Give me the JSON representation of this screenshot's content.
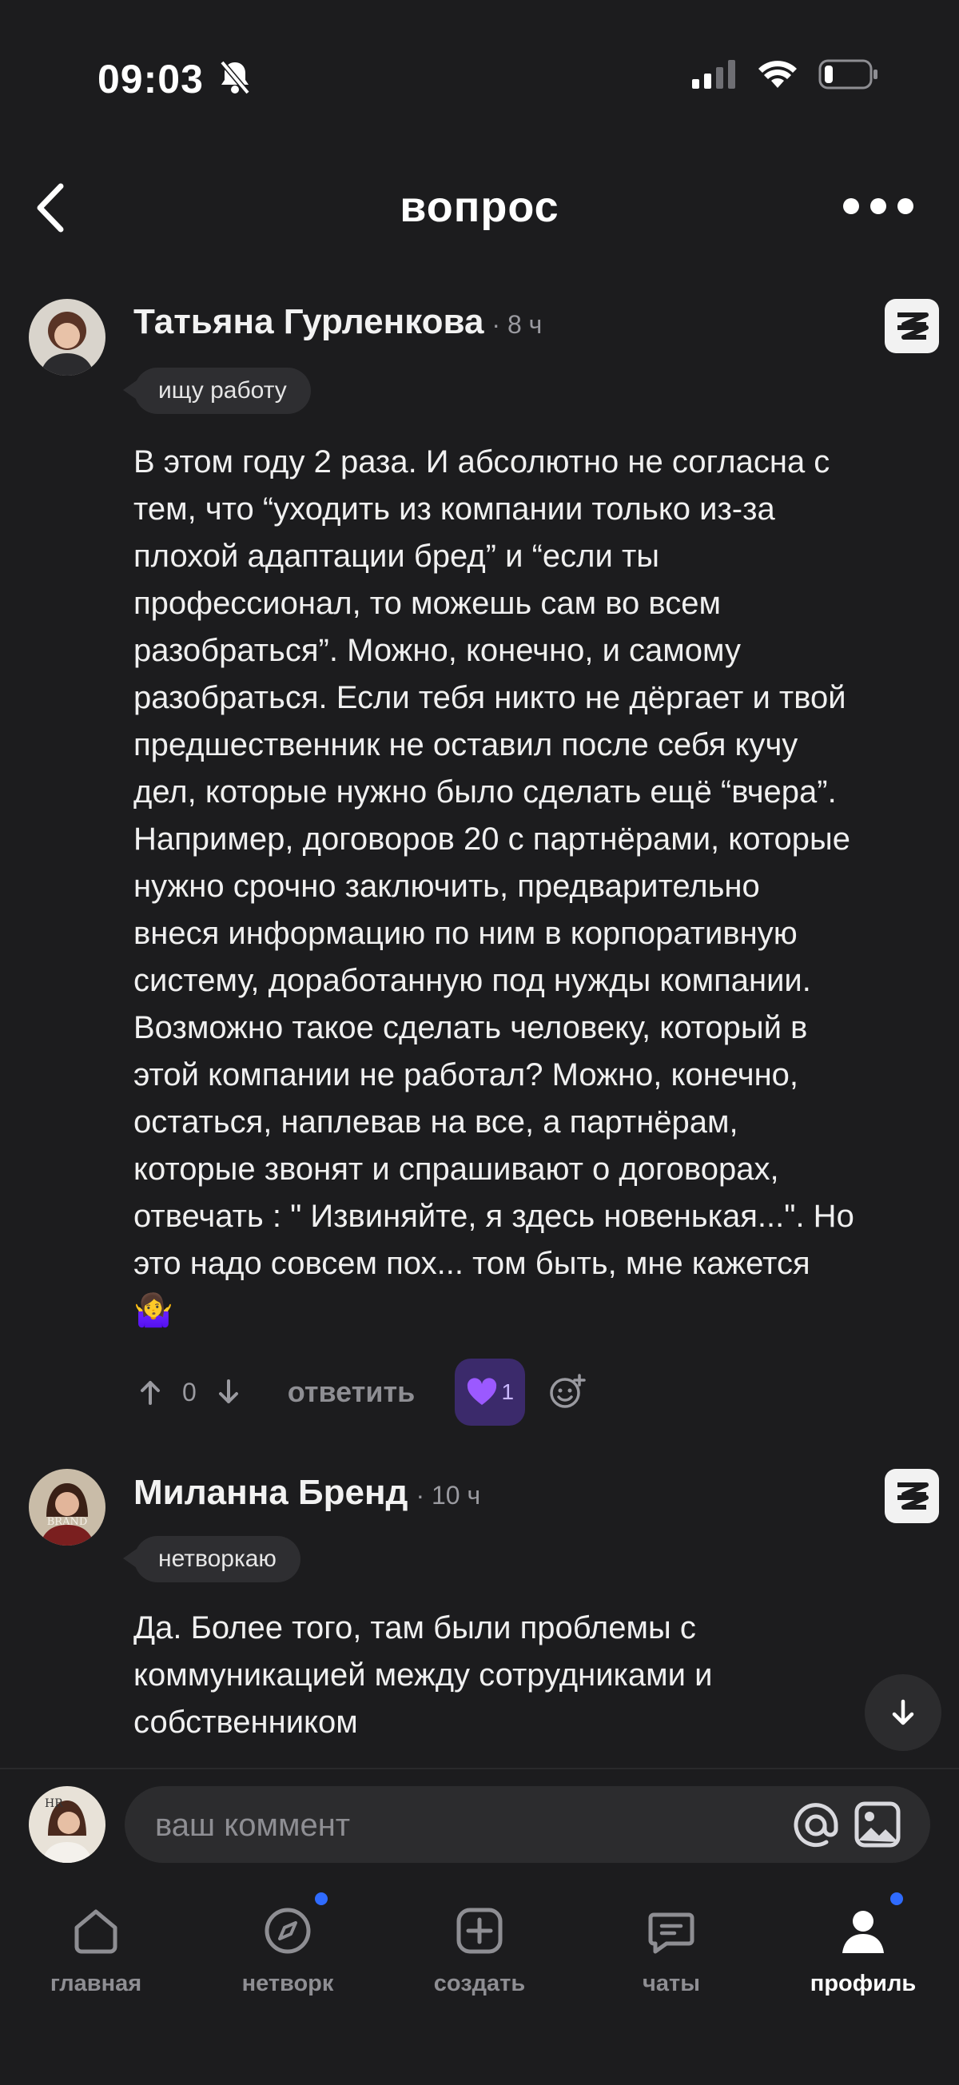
{
  "status_bar": {
    "time": "09:03"
  },
  "header": {
    "title": "вопрос"
  },
  "comments": [
    {
      "author": "Татьяна Гурленкова",
      "time": "· 8 ч",
      "badge": "ищу работу",
      "text": "В этом году 2 раза. И абсолютно не согласна с\nтем, что “уходить из компании только из-за\nплохой адаптации бред” и “если ты\nпрофессионал, то можешь сам во всем\nразобраться”. Можно, конечно, и самому\nразобраться. Если тебя никто не дёргает и твой\nпредшественник не оставил после себя кучу\nдел, которые нужно было сделать ещё “вчера”.\nНапример, договоров 20 с партнёрами, которые\nнужно срочно заключить, предварительно\nвнеся информацию по ним в корпоративную\nсистему, доработанную под нужды компании.\nВозможно такое сделать человеку, который в\nэтой компании не работал? Можно, конечно,\nостаться, наплевав на все, а партнёрам,\nкоторые звонят и спрашивают о договорах,\nотвечать : \" Извиняйте, я здесь новенькая...\". Но\nэто надо совсем пох... том быть, мне кажется\n🤷‍♀️",
      "vote_count": "0",
      "reply_label": "ответить",
      "reaction_count": "1"
    },
    {
      "author": "Миланна Бренд",
      "time": "· 10 ч",
      "badge": "нетворкаю",
      "text": "Да. Более того, там были проблемы с\nкоммуникацией между сотрудниками и\nсобственником"
    }
  ],
  "composer": {
    "placeholder": "ваш коммент"
  },
  "bottom_nav": [
    {
      "label": "главная",
      "icon": "home-icon"
    },
    {
      "label": "нетворк",
      "icon": "compass-icon"
    },
    {
      "label": "создать",
      "icon": "plus-square-icon"
    },
    {
      "label": "чаты",
      "icon": "chat-icon"
    },
    {
      "label": "профиль",
      "icon": "profile-icon"
    }
  ],
  "colors": {
    "background": "#1c1c1e",
    "reaction_bg": "#3b2a6b",
    "notification_dot": "#2f6bff"
  }
}
